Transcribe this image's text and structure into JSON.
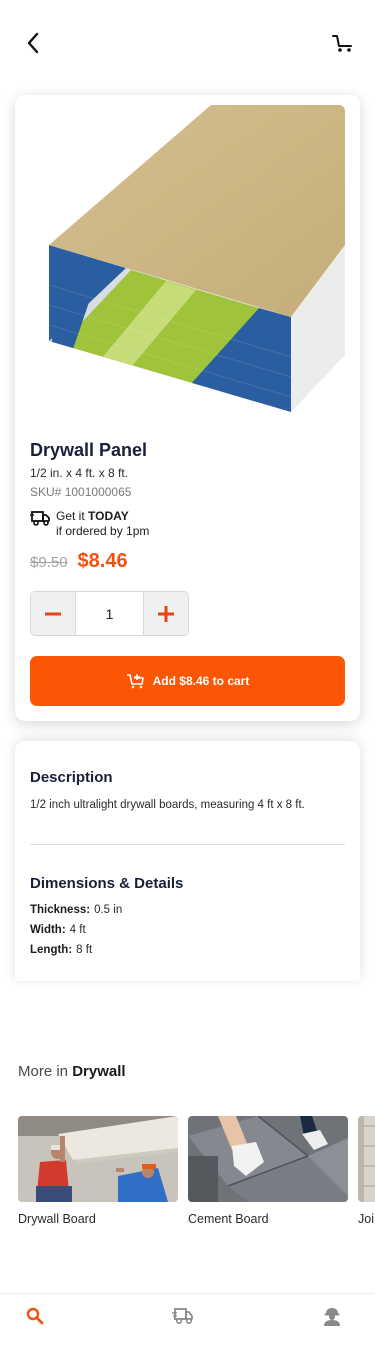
{
  "header": {
    "back_icon": "chevron-left-icon",
    "cart_icon": "cart-icon"
  },
  "product": {
    "title": "Drywall Panel",
    "size": "1/2 in. x 4 ft. x 8 ft.",
    "sku_label": "SKU#",
    "sku": "1001000065",
    "delivery_prefix": "Get it",
    "delivery_strong": "TODAY",
    "delivery_sub": "if ordered by 1pm",
    "old_price": "$9.50",
    "price": "$8.46",
    "quantity": "1",
    "add_to_cart_label": "Add $8.46 to cart",
    "accent_color": "#fc5605"
  },
  "description": {
    "title": "Description",
    "text": "1/2 inch ultralight drywall boards, measuring 4 ft x 8 ft."
  },
  "details": {
    "title": "Dimensions & Details",
    "specs": [
      {
        "label": "Thickness:",
        "value": "0.5 in"
      },
      {
        "label": "Width:",
        "value": "4 ft"
      },
      {
        "label": "Length:",
        "value": "8 ft"
      }
    ]
  },
  "more": {
    "prefix": "More in",
    "category": "Drywall",
    "items": [
      {
        "label": "Drywall Board"
      },
      {
        "label": "Cement Board"
      },
      {
        "label": "Joi"
      }
    ]
  },
  "nav": {
    "items": [
      {
        "icon": "search-icon",
        "active": true
      },
      {
        "icon": "delivery-truck-icon",
        "active": false
      },
      {
        "icon": "worker-profile-icon",
        "active": false
      }
    ]
  }
}
